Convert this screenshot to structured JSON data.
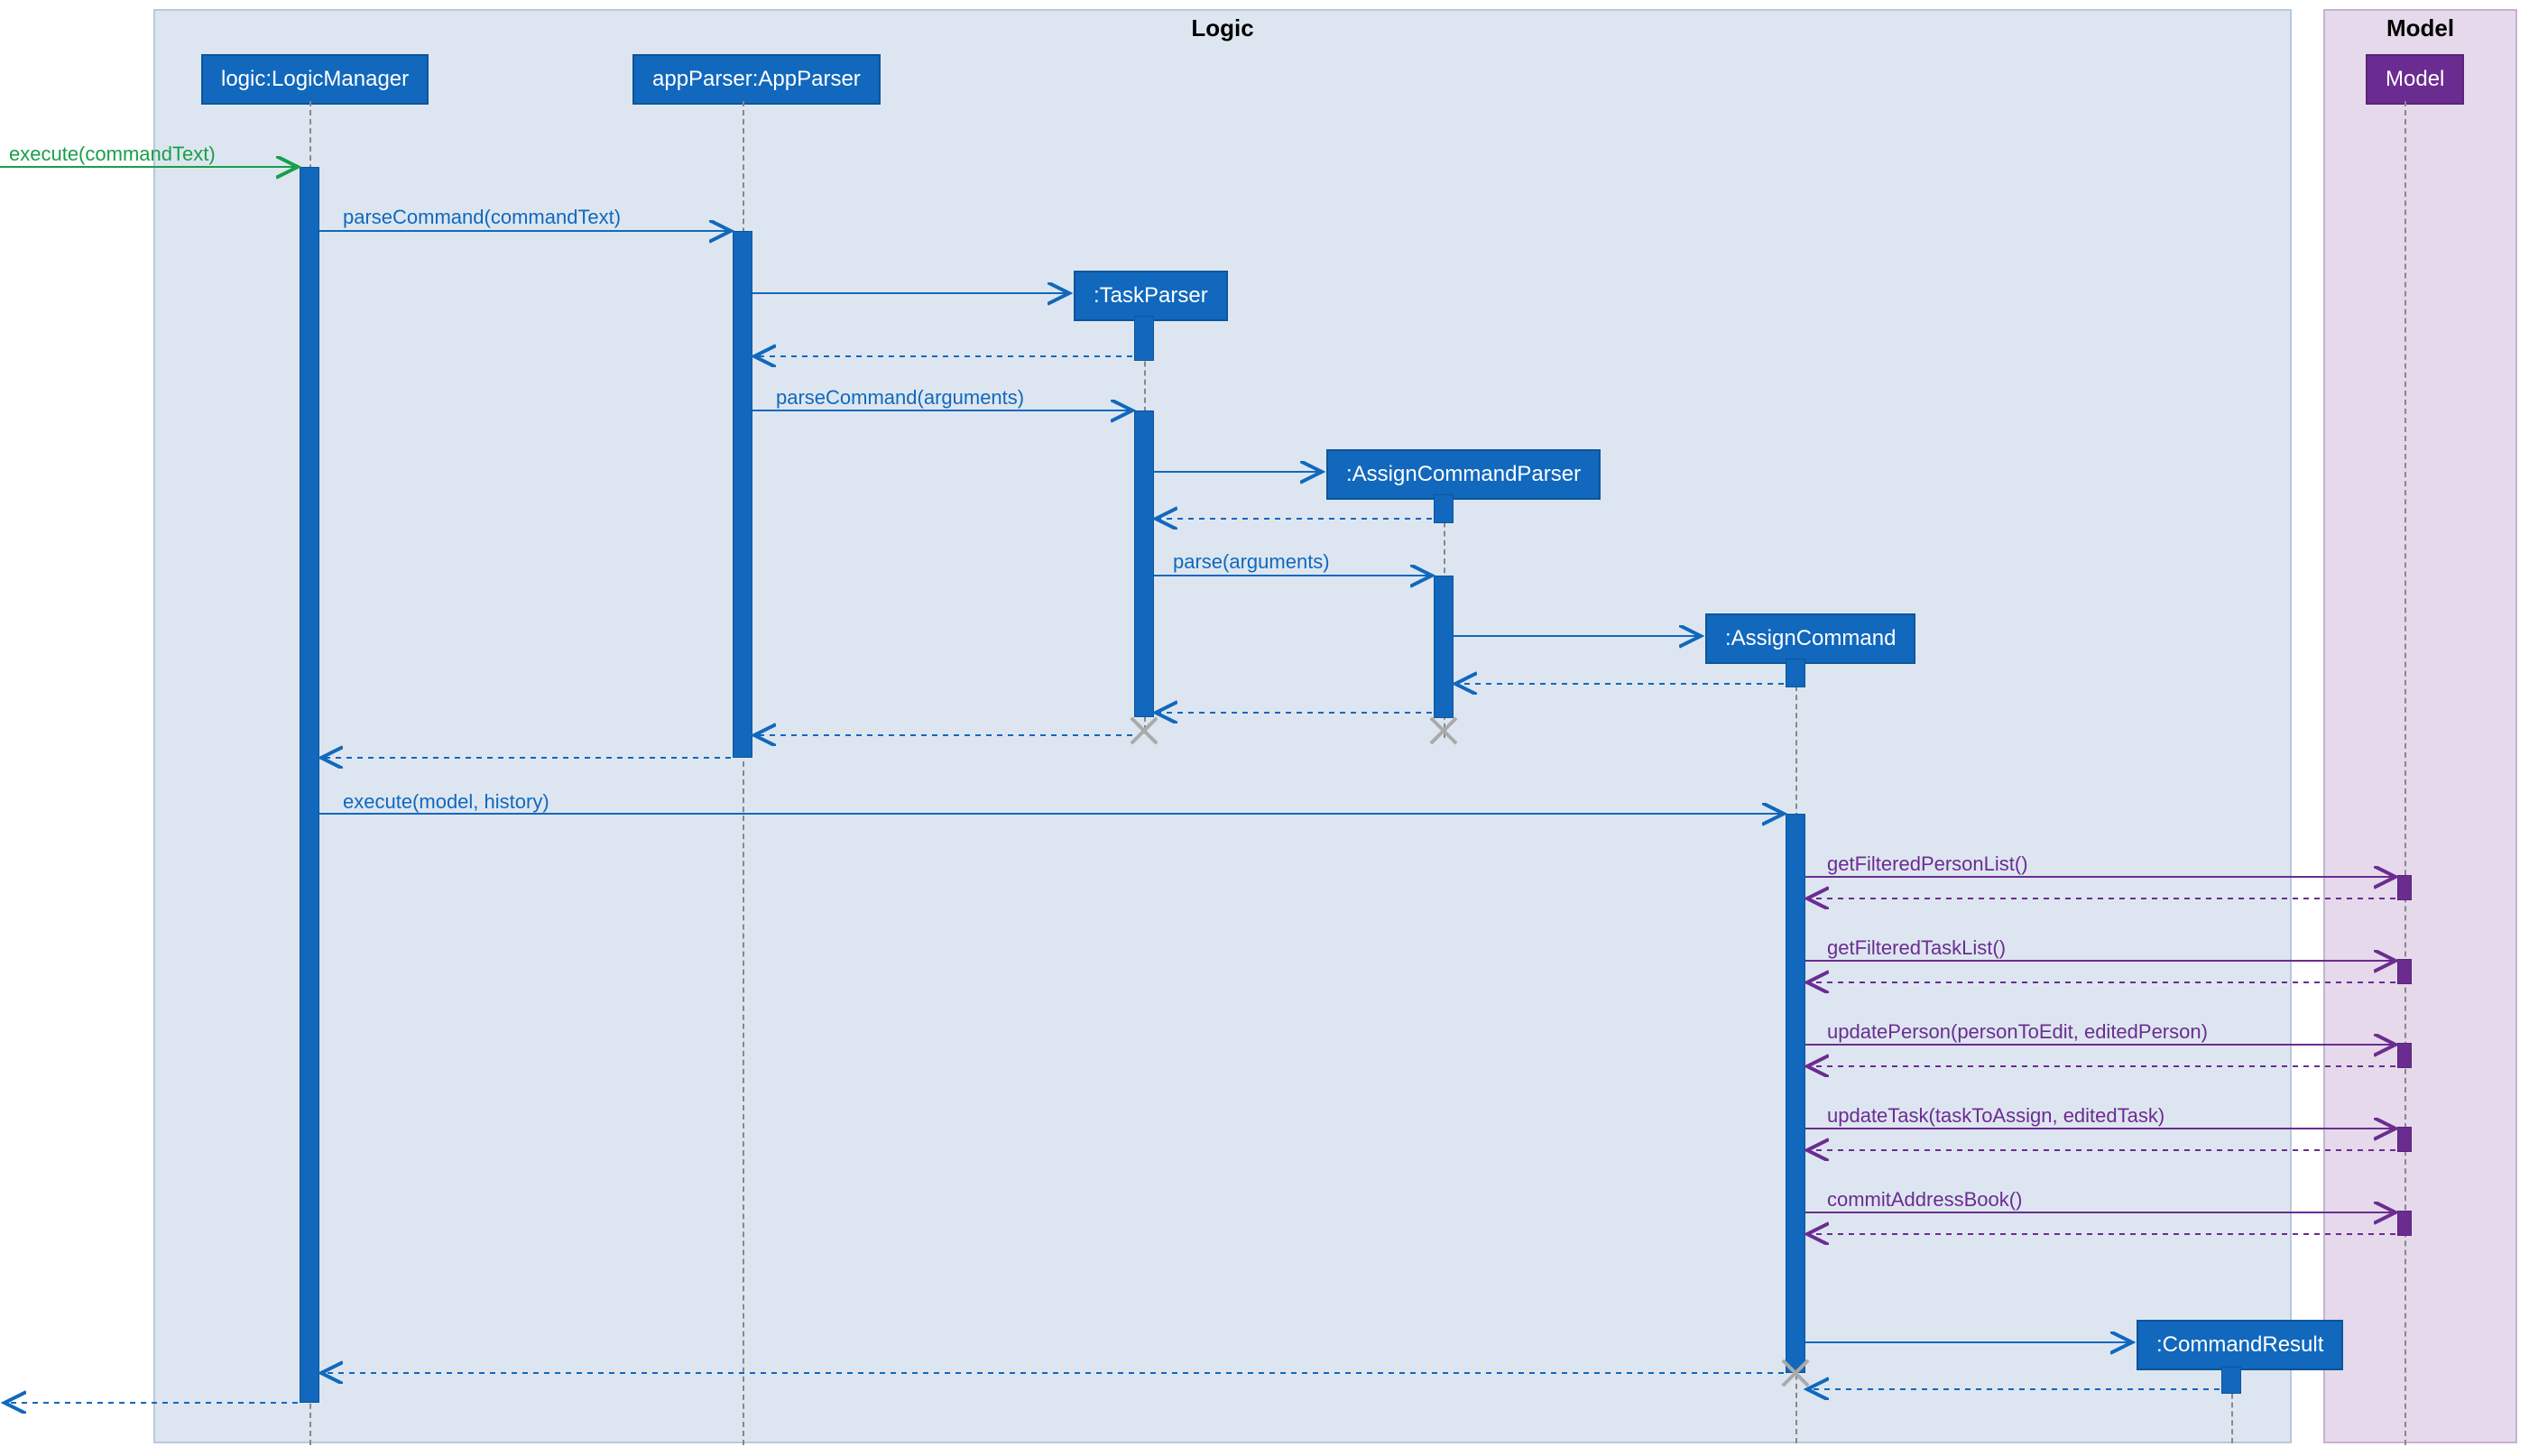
{
  "frames": {
    "logic": "Logic",
    "model": "Model"
  },
  "participants": {
    "logicManager": "logic:LogicManager",
    "appParser": "appParser:AppParser",
    "taskParser": ":TaskParser",
    "assignCmdParser": ":AssignCommandParser",
    "assignCmd": ":AssignCommand",
    "cmdResult": ":CommandResult",
    "model": "Model"
  },
  "messages": {
    "executeCmdText": "execute(commandText)",
    "parseCmdText": "parseCommand(commandText)",
    "parseCmdArgs": "parseCommand(arguments)",
    "parseArgs": "parse(arguments)",
    "executeModelHist": "execute(model, history)",
    "getFilteredPersonList": "getFilteredPersonList()",
    "getFilteredTaskList": "getFilteredTaskList()",
    "updatePerson": "updatePerson(personToEdit, editedPerson)",
    "updateTask": "updateTask(taskToAssign, editedTask)",
    "commitAddressBook": "commitAddressBook()"
  }
}
